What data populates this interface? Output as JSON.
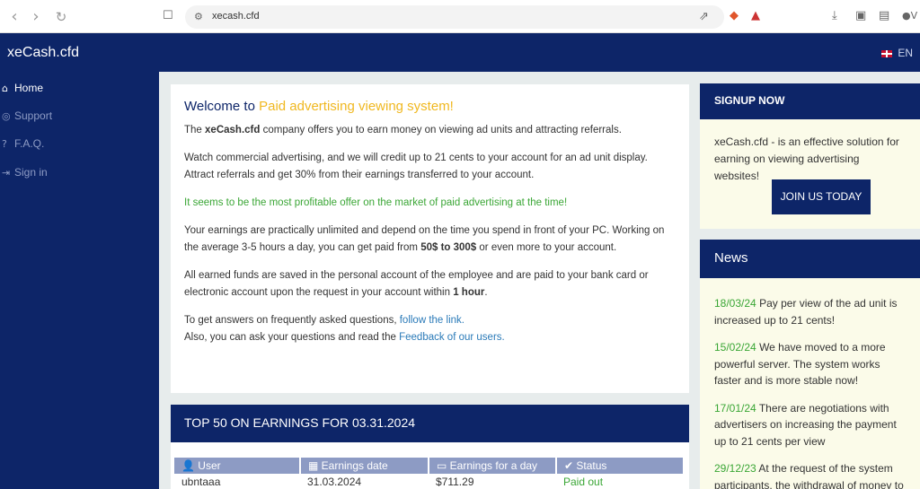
{
  "browser": {
    "back_icon": "chevron-left-icon",
    "forward_icon": "chevron-right-icon",
    "reload_icon": "reload-icon",
    "url": "xecash.cfd",
    "extra_label": "V"
  },
  "header": {
    "brand": "xeCash.cfd",
    "lang": "EN"
  },
  "sidebar": {
    "items": [
      {
        "label": "Home",
        "icon": "home-icon",
        "active": true
      },
      {
        "label": "Support",
        "icon": "support-icon",
        "active": false
      },
      {
        "label": "F.A.Q.",
        "icon": "question-icon",
        "active": false
      },
      {
        "label": "Sign in",
        "icon": "sign-in-icon",
        "active": false
      }
    ]
  },
  "welcome": {
    "title_prefix": "Welcome to",
    "title_highlight": "Paid advertising viewing system!",
    "p1_pre": "The",
    "p1_brand": "xeCash.cfd",
    "p1_post": "company offers you to earn money on viewing ad units and attracting referrals.",
    "p2": "Watch commercial advertising, and we will credit up to 21 cents to your account for an ad unit display. Attract referrals and get 30% from their earnings transferred to your account.",
    "p3": "It seems to be the most profitable offer on the market of paid advertising at the time!",
    "p4_pre": "Your earnings are practically unlimited and depend on the time you spend in front of your PC. Working on the average 3-5 hours a day, you can get paid from",
    "p4_bold": "50$ to 300$",
    "p4_post": "or even more to your account.",
    "p5_pre": "All earned funds are saved in the personal account of the employee and are paid to your bank card or electronic account upon the request in your account within",
    "p5_bold": "1 hour",
    "p5_post": ".",
    "p6_line1_pre": "To get answers on frequently asked questions,",
    "p6_link1": "follow the link.",
    "p6_line2_pre": "Also, you can ask your questions and read the",
    "p6_link2": "Feedback of our users."
  },
  "top50": {
    "title": "TOP 50 ON EARNINGS FOR 03.31.2024",
    "columns": [
      "User",
      "Earnings date",
      "Earnings for a day",
      "Status"
    ],
    "rows": [
      {
        "user": "ubntaaa",
        "date": "31.03.2024",
        "amount": "$711.29",
        "status": "Paid out"
      }
    ]
  },
  "signup": {
    "title": "SIGNUP NOW",
    "text": "xeCash.cfd - is an effective solution for earning on viewing advertising websites!",
    "button": "JOIN US TODAY"
  },
  "news": {
    "title": "News",
    "items": [
      {
        "date": "18/03/24",
        "text": "Pay per view of the ad unit is increased up to 21 cents!"
      },
      {
        "date": "15/02/24",
        "text": "We have moved to a more powerful server. The system works faster and is more stable now!"
      },
      {
        "date": "17/01/24",
        "text": "There are negotiations with advertisers on increasing the payment up to 21 cents per view"
      },
      {
        "date": "29/12/23",
        "text": "At the request of the system participants, the withdrawal of money to"
      }
    ]
  }
}
